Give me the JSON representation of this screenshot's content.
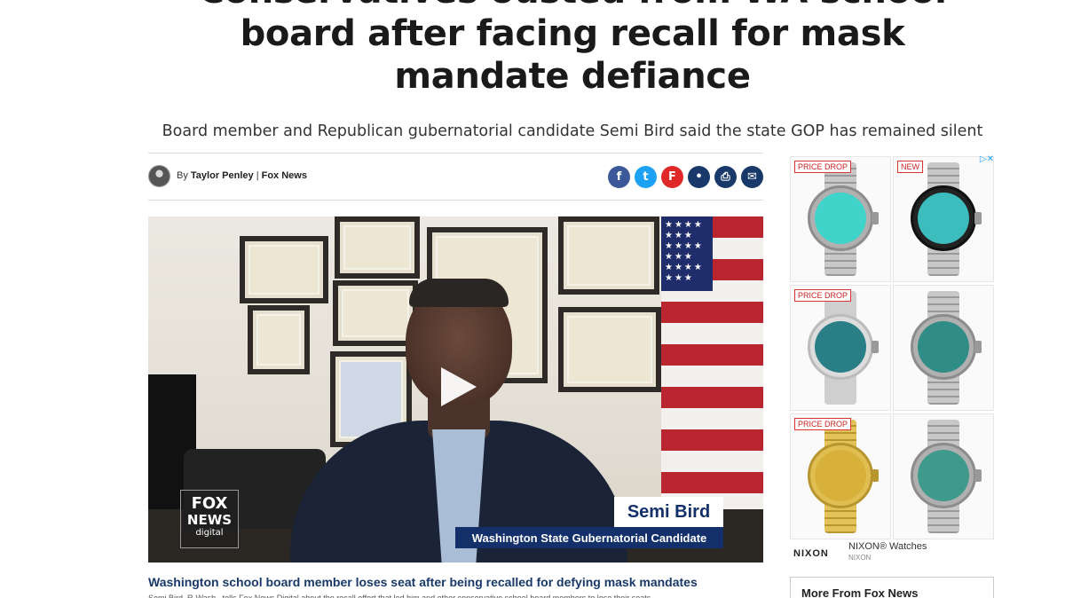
{
  "article": {
    "headline_lines": [
      "Conservatives ousted from WA school",
      "board after facing recall for mask",
      "mandate defiance"
    ],
    "subhead": "Board member and Republican gubernatorial candidate Semi Bird said the state GOP has remained silent",
    "byline": {
      "prefix": "By",
      "author": "Taylor Penley",
      "separator": "|",
      "outlet": "Fox News"
    },
    "share": [
      {
        "name": "facebook-icon",
        "glyph": "f"
      },
      {
        "name": "twitter-icon",
        "glyph": "t"
      },
      {
        "name": "flipboard-icon",
        "glyph": "F"
      },
      {
        "name": "comment-icon",
        "glyph": "•"
      },
      {
        "name": "print-icon",
        "glyph": "⎙"
      },
      {
        "name": "email-icon",
        "glyph": "✉"
      }
    ]
  },
  "video": {
    "logo": {
      "line1": "FOX",
      "line2": "NEWS",
      "line3": "digital"
    },
    "lower_third_name": "Semi Bird",
    "lower_third_title": "Washington State Gubernatorial Candidate",
    "caption": "Washington school board member loses seat after being recalled for defying mask mandates",
    "caption_sub": "Semi Bird, R-Wash., tells Fox News Digital about the recall effort that led him and other conservative school board members to lose their seats."
  },
  "ad": {
    "badges": [
      "PRICE DROP",
      "NEW",
      "PRICE DROP",
      "",
      "PRICE DROP",
      ""
    ],
    "brand_logo": "NIXON",
    "title": "NIXON® Watches",
    "sub": "NIXON",
    "adchoices": "▷✕",
    "faces": [
      "#3fd3c9",
      "#3cbcbc",
      "#2a7f86",
      "#2f8c86",
      "#d8b13a",
      "#3f9a8c"
    ]
  },
  "sidebar": {
    "more_title": "More From Fox News"
  }
}
